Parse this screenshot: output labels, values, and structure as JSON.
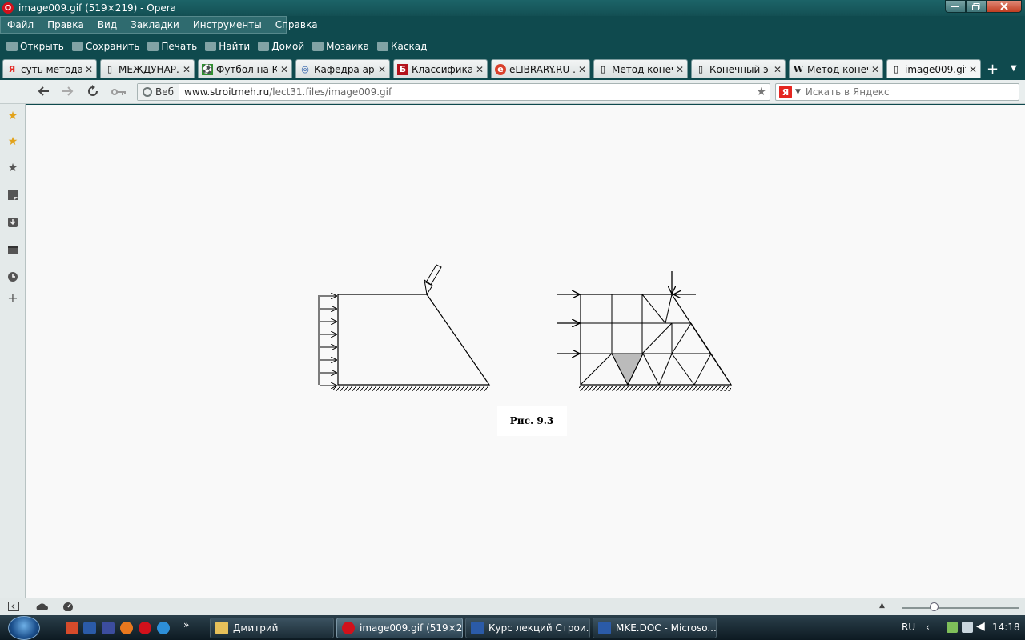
{
  "window": {
    "title": "image009.gif (519×219) - Opera"
  },
  "menu": [
    "Файл",
    "Правка",
    "Вид",
    "Закладки",
    "Инструменты",
    "Справка"
  ],
  "toolbar": [
    "Открыть",
    "Сохранить",
    "Печать",
    "Найти",
    "Домой",
    "Мозаика",
    "Каскад"
  ],
  "tabs": [
    {
      "label": "суть метода ...",
      "icon": "yandex-icon"
    },
    {
      "label": "МЕЖДУНАР...",
      "icon": "page-icon"
    },
    {
      "label": "Футбол на К...",
      "icon": "football-icon"
    },
    {
      "label": "Кафедра арх...",
      "icon": "university-icon"
    },
    {
      "label": "Классифика...",
      "icon": "b-letter-icon"
    },
    {
      "label": "eLIBRARY.RU ...",
      "icon": "elibrary-icon"
    },
    {
      "label": "Метод конеч...",
      "icon": "page-icon"
    },
    {
      "label": "Конечный э...",
      "icon": "page-icon"
    },
    {
      "label": "Метод конеч...",
      "icon": "wikipedia-icon"
    },
    {
      "label": "image009.gif ...",
      "icon": "page-icon"
    }
  ],
  "address": {
    "badge": "Веб",
    "url_domain": "www.stroitmeh.ru",
    "url_path": "/lect31.files/image009.gif",
    "search_placeholder": "Искать в Яндекс"
  },
  "figure": {
    "caption": "Рис. 9.3"
  },
  "taskbar": {
    "buttons": [
      "Дмитрий",
      "image009.gif (519×2...",
      "Курс лекций Строи...",
      "MKE.DOC - Microso..."
    ],
    "lang": "RU",
    "time": "14:18"
  }
}
